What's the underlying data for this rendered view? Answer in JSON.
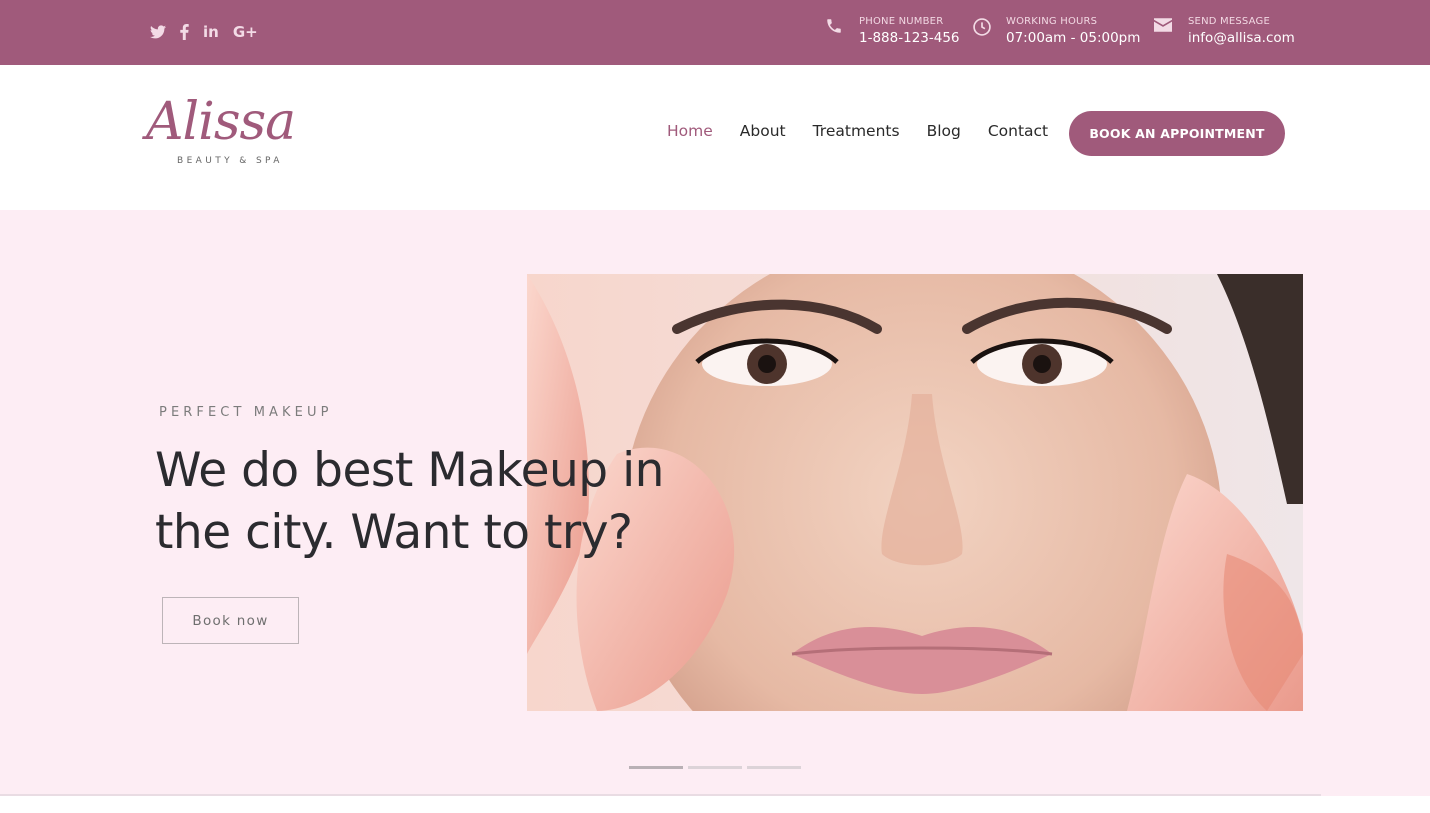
{
  "colors": {
    "brand": "#a05a7b",
    "hero_bg": "#fdedf4",
    "text_dark": "#2b2b2f"
  },
  "topbar": {
    "socials": [
      {
        "name": "twitter-icon"
      },
      {
        "name": "facebook-icon"
      },
      {
        "name": "linkedin-icon",
        "glyph": "in"
      },
      {
        "name": "google-plus-icon",
        "glyph": "G+"
      }
    ],
    "phone": {
      "label": "PHONE NUMBER",
      "value": "1-888-123-456",
      "icon": "phone-icon"
    },
    "hours": {
      "label": "WORKING HOURS",
      "value": "07:00am - 05:00pm",
      "icon": "clock-icon"
    },
    "message": {
      "label": "SEND MESSAGE",
      "value": "info@allisa.com",
      "icon": "envelope-icon"
    }
  },
  "header": {
    "logo": {
      "script": "Alissa",
      "sub": "BEAUTY & SPA"
    },
    "nav": [
      "Home",
      "About",
      "Treatments",
      "Blog",
      "Contact"
    ],
    "active_nav": "Home",
    "cta": "BOOK AN APPOINTMENT"
  },
  "hero": {
    "eyebrow": "PERFECT MAKEUP",
    "headline": "We do best Makeup in the city. Want to try?",
    "button": "Book now",
    "slides": 3,
    "active_slide": 1
  }
}
